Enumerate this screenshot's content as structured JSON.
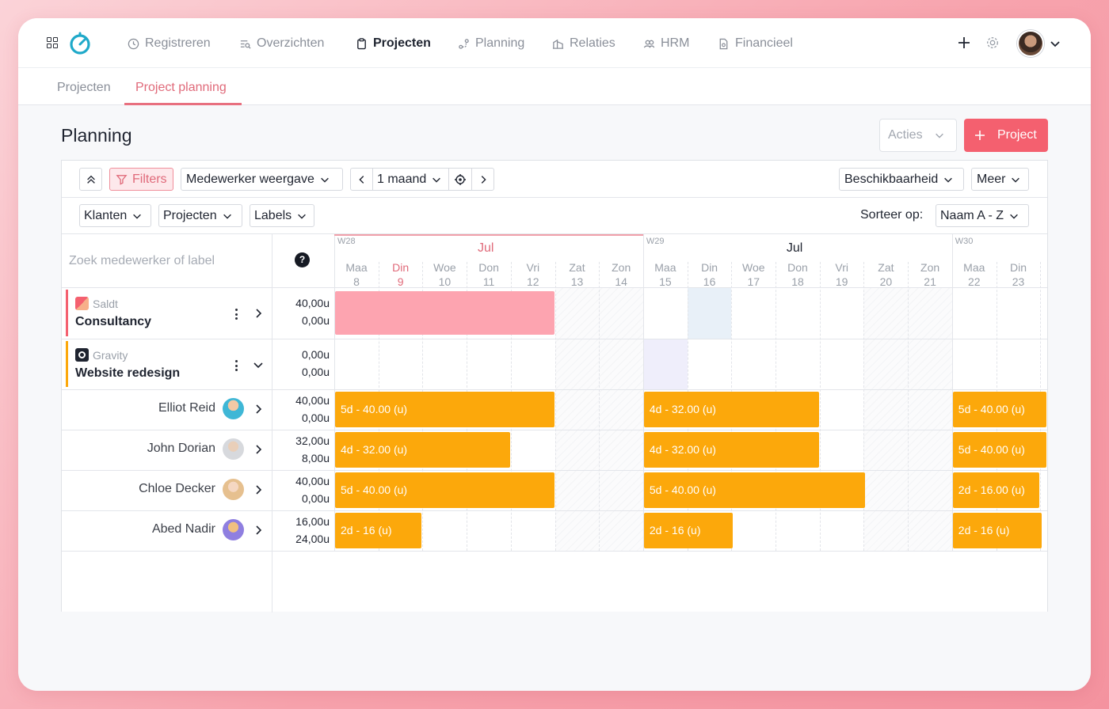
{
  "nav": {
    "items": [
      {
        "label": "Registreren",
        "icon": "clock-icon"
      },
      {
        "label": "Overzichten",
        "icon": "overview-icon"
      },
      {
        "label": "Projecten",
        "icon": "clipboard-icon"
      },
      {
        "label": "Planning",
        "icon": "planning-icon"
      },
      {
        "label": "Relaties",
        "icon": "building-icon"
      },
      {
        "label": "HRM",
        "icon": "people-icon"
      },
      {
        "label": "Financieel",
        "icon": "document-icon"
      }
    ],
    "active": "Projecten"
  },
  "subnav": {
    "tabs": [
      {
        "label": "Projecten"
      },
      {
        "label": "Project planning"
      }
    ],
    "active": "Project planning"
  },
  "page": {
    "title": "Planning",
    "acties_label": "Acties",
    "project_label": "Project"
  },
  "toolbar": {
    "filters_label": "Filters",
    "view_label": "Medewerker weergave",
    "period_label": "1 maand",
    "availability_label": "Beschikbaarheid",
    "more_label": "Meer",
    "klanten_label": "Klanten",
    "projecten_label": "Projecten",
    "labels_label": "Labels",
    "sort_label": "Sorteer op:",
    "sort_value": "Naam A - Z"
  },
  "grid": {
    "search_placeholder": "Zoek medewerker of label",
    "help_glyph": "?",
    "weeks": [
      {
        "label": "W28",
        "month": "Jul"
      },
      {
        "label": "W29",
        "month": "Jul"
      },
      {
        "label": "W30"
      }
    ],
    "days": [
      {
        "name": "Maa",
        "num": "8"
      },
      {
        "name": "Din",
        "num": "9"
      },
      {
        "name": "Woe",
        "num": "10"
      },
      {
        "name": "Don",
        "num": "11"
      },
      {
        "name": "Vri",
        "num": "12"
      },
      {
        "name": "Zat",
        "num": "13"
      },
      {
        "name": "Zon",
        "num": "14"
      },
      {
        "name": "Maa",
        "num": "15"
      },
      {
        "name": "Din",
        "num": "16"
      },
      {
        "name": "Woe",
        "num": "17"
      },
      {
        "name": "Don",
        "num": "18"
      },
      {
        "name": "Vri",
        "num": "19"
      },
      {
        "name": "Zat",
        "num": "20"
      },
      {
        "name": "Zon",
        "num": "21"
      },
      {
        "name": "Maa",
        "num": "22"
      },
      {
        "name": "Din",
        "num": "23"
      }
    ],
    "projects": [
      {
        "client": "Saldt",
        "name": "Consultancy",
        "hours_top": "40,00u",
        "hours_bottom": "0,00u",
        "accent": "#f4606f"
      },
      {
        "client": "Gravity",
        "name": "Website redesign",
        "hours_top": "0,00u",
        "hours_bottom": "0,00u",
        "accent": "#fca80b"
      }
    ],
    "employees": [
      {
        "name": "Elliot Reid",
        "hours_top": "40,00u",
        "hours_bottom": "0,00u",
        "blocks": [
          "5d - 40.00 (u)",
          "4d - 32.00 (u)",
          "5d - 40.00 (u)"
        ]
      },
      {
        "name": "John Dorian",
        "hours_top": "32,00u",
        "hours_bottom": "8,00u",
        "blocks": [
          "4d - 32.00 (u)",
          "4d - 32.00 (u)",
          "5d - 40.00 (u)"
        ]
      },
      {
        "name": "Chloe Decker",
        "hours_top": "40,00u",
        "hours_bottom": "0,00u",
        "blocks": [
          "5d - 40.00 (u)",
          "5d - 40.00 (u)",
          "2d - 16.00 (u)"
        ]
      },
      {
        "name": "Abed Nadir",
        "hours_top": "16,00u",
        "hours_bottom": "24,00u",
        "blocks": [
          "2d - 16 (u)",
          "2d - 16 (u)",
          "2d - 16 (u)"
        ]
      }
    ]
  },
  "colors": {
    "accent": "#f4606f",
    "block": "#fca80b",
    "consultancy_fill": "#fda4b0"
  }
}
